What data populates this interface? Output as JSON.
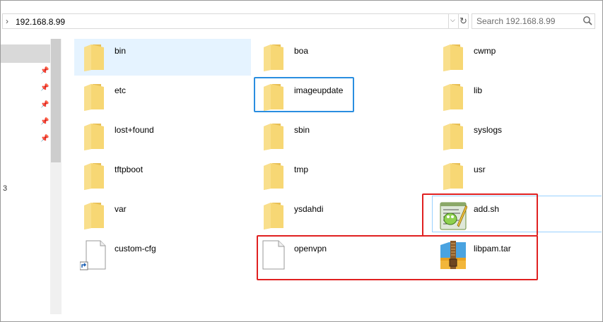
{
  "address": {
    "chevron": "›",
    "path": "192.168.8.99"
  },
  "search": {
    "placeholder": "Search 192.168.8.99"
  },
  "nav": {
    "stub_text": "3"
  },
  "files": [
    {
      "name": "bin",
      "type": "folder",
      "selected": true
    },
    {
      "name": "boa",
      "type": "folder"
    },
    {
      "name": "cwmp",
      "type": "folder"
    },
    {
      "name": "etc",
      "type": "folder"
    },
    {
      "name": "imageupdate",
      "type": "folder"
    },
    {
      "name": "lib",
      "type": "folder"
    },
    {
      "name": "lost+found",
      "type": "folder"
    },
    {
      "name": "sbin",
      "type": "folder"
    },
    {
      "name": "syslogs",
      "type": "folder"
    },
    {
      "name": "tftpboot",
      "type": "folder"
    },
    {
      "name": "tmp",
      "type": "folder"
    },
    {
      "name": "usr",
      "type": "folder"
    },
    {
      "name": "var",
      "type": "folder"
    },
    {
      "name": "ysdahdi",
      "type": "folder"
    },
    {
      "name": "add.sh",
      "type": "script"
    },
    {
      "name": "custom-cfg",
      "type": "shortcut"
    },
    {
      "name": "openvpn",
      "type": "file"
    },
    {
      "name": "libpam.tar",
      "type": "archive"
    }
  ],
  "colors": {
    "highlight_blue": "#2a8ee0",
    "highlight_red": "#e02020",
    "selection": "#e5f3ff",
    "folder": "#f7d774"
  }
}
